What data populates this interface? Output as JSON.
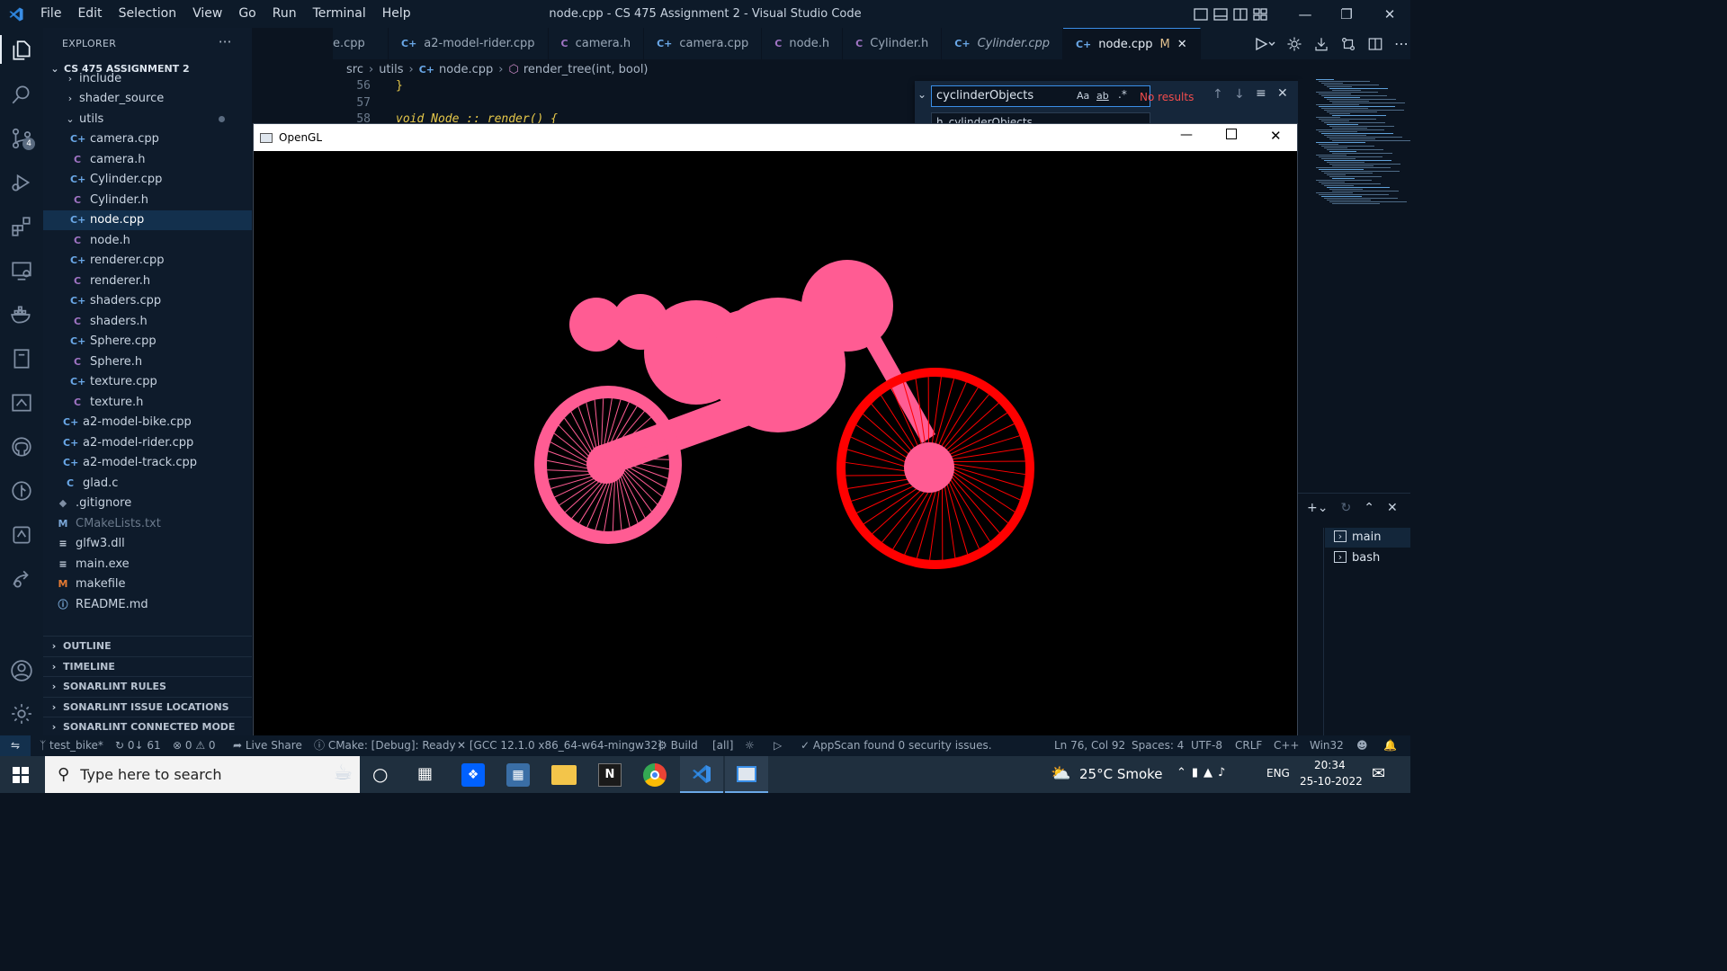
{
  "window": {
    "title": "node.cpp - CS 475 Assignment 2 - Visual Studio Code"
  },
  "menu": [
    "File",
    "Edit",
    "Selection",
    "View",
    "Go",
    "Run",
    "Terminal",
    "Help"
  ],
  "explorer": {
    "header": "EXPLORER",
    "project": "CS 475 ASSIGNMENT 2",
    "items": [
      {
        "name": "include",
        "kind": "folder",
        "indent": 1
      },
      {
        "name": "shader_source",
        "kind": "folder",
        "indent": 1
      },
      {
        "name": "utils",
        "kind": "folder-open",
        "indent": 1
      },
      {
        "name": "camera.cpp",
        "kind": "cpp",
        "indent": 2
      },
      {
        "name": "camera.h",
        "kind": "h",
        "indent": 2
      },
      {
        "name": "Cylinder.cpp",
        "kind": "cpp",
        "indent": 2
      },
      {
        "name": "Cylinder.h",
        "kind": "h",
        "indent": 2
      },
      {
        "name": "node.cpp",
        "kind": "cpp",
        "indent": 2,
        "selected": true
      },
      {
        "name": "node.h",
        "kind": "h",
        "indent": 2
      },
      {
        "name": "renderer.cpp",
        "kind": "cpp",
        "indent": 2
      },
      {
        "name": "renderer.h",
        "kind": "h",
        "indent": 2
      },
      {
        "name": "shaders.cpp",
        "kind": "cpp",
        "indent": 2
      },
      {
        "name": "shaders.h",
        "kind": "h",
        "indent": 2
      },
      {
        "name": "Sphere.cpp",
        "kind": "cpp",
        "indent": 2
      },
      {
        "name": "Sphere.h",
        "kind": "h",
        "indent": 2
      },
      {
        "name": "texture.cpp",
        "kind": "cpp",
        "indent": 2
      },
      {
        "name": "texture.h",
        "kind": "h",
        "indent": 2
      },
      {
        "name": "a2-model-bike.cpp",
        "kind": "cpp",
        "indent": 1
      },
      {
        "name": "a2-model-rider.cpp",
        "kind": "cpp",
        "indent": 1
      },
      {
        "name": "a2-model-track.cpp",
        "kind": "cpp",
        "indent": 1
      },
      {
        "name": "glad.c",
        "kind": "c",
        "indent": 1
      },
      {
        "name": ".gitignore",
        "kind": "git",
        "indent": 0
      },
      {
        "name": "CMakeLists.txt",
        "kind": "cmake",
        "indent": 0
      },
      {
        "name": "glfw3.dll",
        "kind": "file",
        "indent": 0
      },
      {
        "name": "main.exe",
        "kind": "file",
        "indent": 0
      },
      {
        "name": "makefile",
        "kind": "make",
        "indent": 0
      },
      {
        "name": "README.md",
        "kind": "info",
        "indent": 0
      }
    ],
    "sections": [
      "OUTLINE",
      "TIMELINE",
      "SONARLINT RULES",
      "SONARLINT ISSUE LOCATIONS",
      "SONARLINT CONNECTED MODE"
    ]
  },
  "tabs": [
    {
      "label": "e.cpp",
      "icon": "cpp"
    },
    {
      "label": "a2-model-rider.cpp",
      "icon": "cpp"
    },
    {
      "label": "camera.h",
      "icon": "h"
    },
    {
      "label": "camera.cpp",
      "icon": "cpp"
    },
    {
      "label": "node.h",
      "icon": "h"
    },
    {
      "label": "Cylinder.h",
      "icon": "h"
    },
    {
      "label": "Cylinder.cpp",
      "icon": "cpp",
      "italic": true
    },
    {
      "label": "node.cpp",
      "icon": "cpp",
      "active": true,
      "modified": "M"
    }
  ],
  "breadcrumb": [
    "src",
    "utils",
    "node.cpp",
    "render_tree(int, bool)"
  ],
  "code": [
    {
      "line": "56",
      "text": "}"
    },
    {
      "line": "57",
      "text": ""
    },
    {
      "line": "58",
      "text": "void Node :: render() {"
    }
  ],
  "find": {
    "query": "cyclinderObjects",
    "result": "No results",
    "replace_partial": "h_cylinderObjects",
    "opt_case": "Aa",
    "opt_word": "ab",
    "opt_regex": ".*"
  },
  "terminal": {
    "items": [
      "main",
      "bash"
    ]
  },
  "opengl": {
    "title": "OpenGL",
    "colors": {
      "pink": "#ff5c93",
      "red": "#ff0000",
      "background": "#000000"
    }
  },
  "status": {
    "branch": "test_bike*",
    "sync": "0↓ 61",
    "errors": "0",
    "warnings": "0",
    "liveshare": "Live Share",
    "cmake": "CMake: [Debug]: Ready",
    "kit": "[GCC 12.1.0 x86_64-w64-mingw32]",
    "build": "Build",
    "target": "[all]",
    "appscan": "AppScan found 0 security issues.",
    "position": "Ln 76, Col 92",
    "spaces": "Spaces: 4",
    "encoding": "UTF-8",
    "eol": "CRLF",
    "language": "C++",
    "platform": "Win32"
  },
  "taskbar": {
    "search_placeholder": "Type here to search",
    "weather": "25°C  Smoke",
    "lang": "ENG",
    "time": "20:34",
    "date": "25-10-2022"
  },
  "accent": "#3a8ee6"
}
